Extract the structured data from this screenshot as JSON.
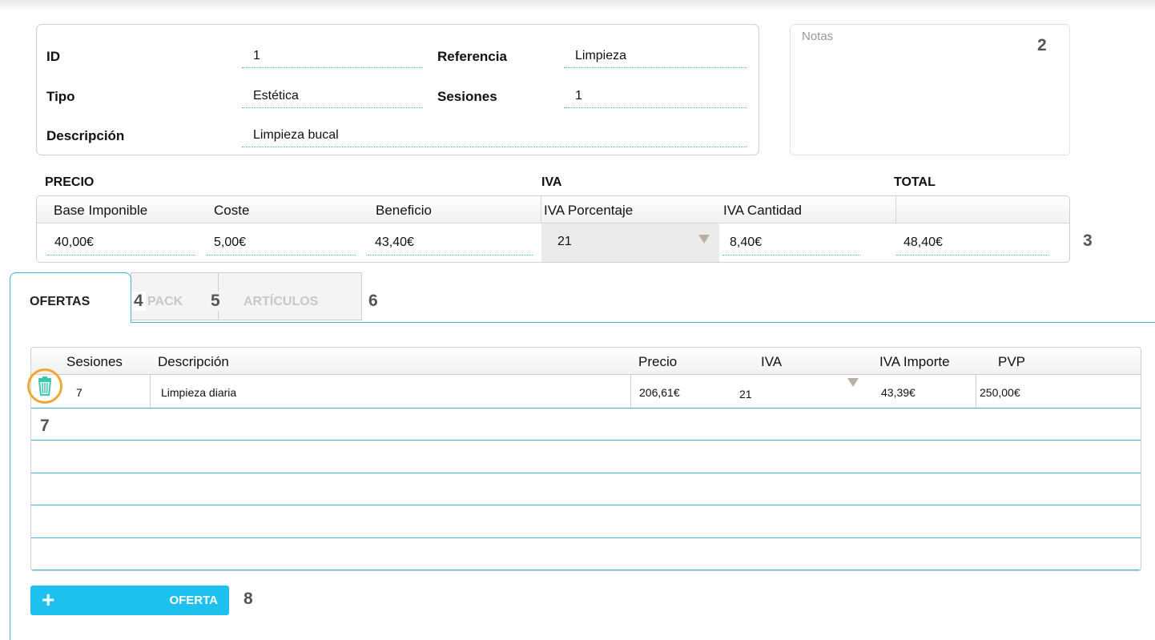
{
  "info": {
    "id_label": "ID",
    "id_value": "1",
    "referencia_label": "Referencia",
    "referencia_value": "Limpieza",
    "tipo_label": "Tipo",
    "tipo_value": "Estética",
    "sesiones_label": "Sesiones",
    "sesiones_value": "1",
    "descripcion_label": "Descripción",
    "descripcion_value": "Limpieza bucal"
  },
  "notes": {
    "label": "Notas"
  },
  "price": {
    "precio_title": "PRECIO",
    "iva_title": "IVA",
    "total_title": "TOTAL",
    "headers": {
      "base": "Base Imponible",
      "coste": "Coste",
      "beneficio": "Beneficio",
      "iva_porcentaje": "IVA Porcentaje",
      "iva_cantidad": "IVA Cantidad"
    },
    "values": {
      "base": "40,00€",
      "coste": "5,00€",
      "beneficio": "43,40€",
      "iva_porcentaje": "21",
      "iva_cantidad": "8,40€",
      "total": "48,40€"
    }
  },
  "tabs": [
    {
      "label": "OFERTAS",
      "active": true
    },
    {
      "label": "PACK",
      "active": false
    },
    {
      "label": "ARTÍCULOS",
      "active": false
    }
  ],
  "offers": {
    "columns": [
      "Sesiones",
      "Descripción",
      "Precio",
      "IVA",
      "IVA Importe",
      "PVP"
    ],
    "rows": [
      {
        "sesiones": "7",
        "descripcion": "Limpieza diaria",
        "precio": "206,61€",
        "iva": "21",
        "iva_importe": "43,39€",
        "pvp": "250,00€"
      }
    ],
    "add_button": {
      "icon": "+",
      "label": "OFERTA"
    }
  },
  "callouts": [
    "2",
    "3",
    "4",
    "5",
    "6",
    "7",
    "8"
  ],
  "colors": {
    "accent": "#1ec1ee",
    "line": "#3fb8d8",
    "highlight": "#f0a733"
  }
}
